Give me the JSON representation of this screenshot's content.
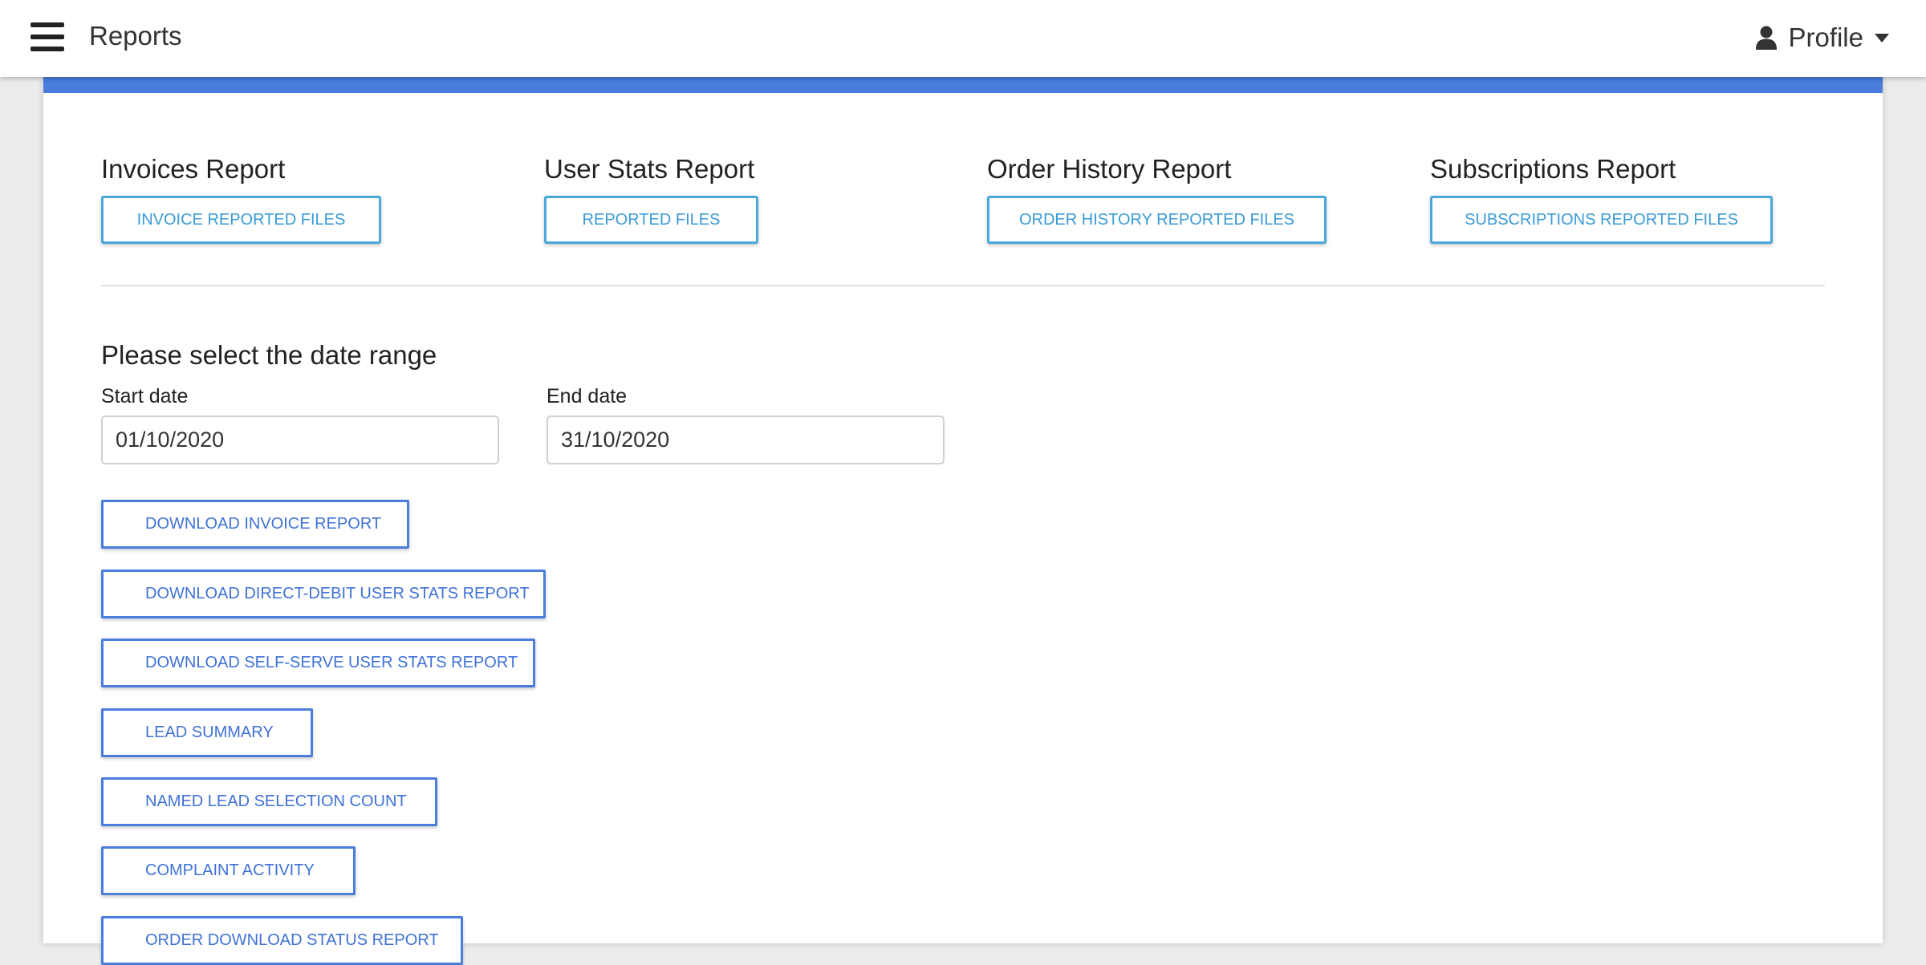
{
  "header": {
    "menu_icon": "hamburger-menu-icon",
    "title": "Reports",
    "profile_icon": "user-icon",
    "profile_label": "Profile"
  },
  "colors": {
    "accent": "#4a7ddc",
    "report_button": "#3a9bd6",
    "action_button": "#3f72d6"
  },
  "reports": [
    {
      "title": "Invoices Report",
      "button": "INVOICE REPORTED FILES"
    },
    {
      "title": "User Stats Report",
      "button": "REPORTED FILES"
    },
    {
      "title": "Order History Report",
      "button": "ORDER HISTORY REPORTED FILES"
    },
    {
      "title": "Subscriptions Report",
      "button": "SUBSCRIPTIONS REPORTED FILES"
    }
  ],
  "date_range": {
    "heading": "Please select the date range",
    "start_label": "Start date",
    "start_value": "01/10/2020",
    "end_label": "End date",
    "end_value": "31/10/2020"
  },
  "actions": [
    "DOWNLOAD INVOICE REPORT",
    "DOWNLOAD DIRECT-DEBIT USER STATS REPORT",
    "DOWNLOAD SELF-SERVE USER STATS REPORT",
    "LEAD SUMMARY",
    "NAMED LEAD SELECTION COUNT",
    "COMPLAINT ACTIVITY",
    "ORDER DOWNLOAD STATUS REPORT"
  ]
}
